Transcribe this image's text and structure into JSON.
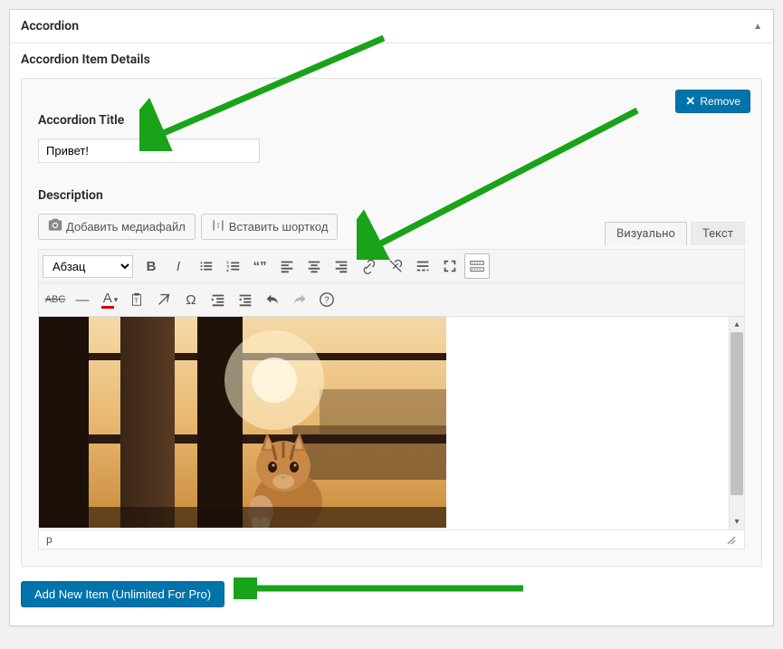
{
  "panel": {
    "title": "Accordion",
    "section_title": "Accordion Item Details",
    "remove_label": "Remove"
  },
  "fields": {
    "title_label": "Accordion Title",
    "title_value": "Привет!",
    "description_label": "Description"
  },
  "media": {
    "add_media": "Добавить медиафайл",
    "insert_shortcode": "Вставить шорткод"
  },
  "editor": {
    "tab_visual": "Визуально",
    "tab_text": "Текст",
    "format_option": "Абзац",
    "status_path": "p"
  },
  "add_button": "Add New Item (Unlimited For Pro)"
}
